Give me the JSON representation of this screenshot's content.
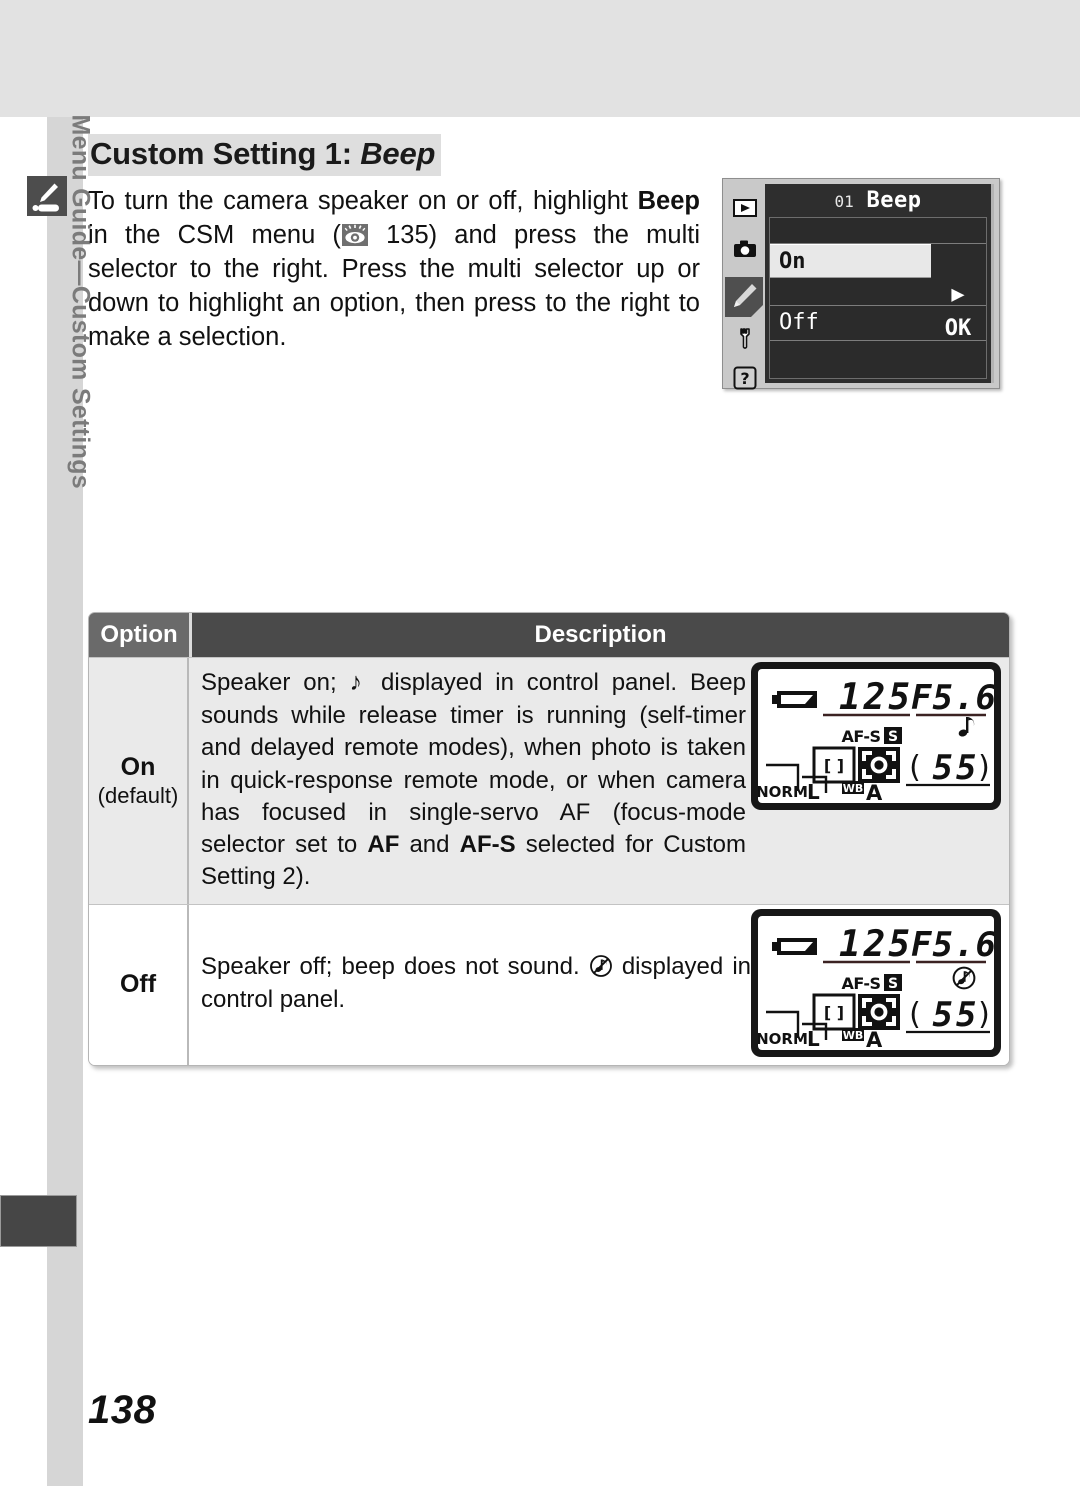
{
  "document": {
    "page_number": "138",
    "side_tab_label": "Menu Guide—Custom Settings",
    "side_tab_icon": "pencil-icon"
  },
  "heading": {
    "prefix": "Custom Setting 1: ",
    "italic_term": "Beep"
  },
  "intro": {
    "part1": "To turn the camera speaker on or off, highlight ",
    "bold_term": "Beep",
    "part2": " in the CSM menu (",
    "ref_icon": "reference-eye-icon",
    "part3": " 135) and press the multi selector to the right.  Press the multi selector up or down to highlight an option, then press to the right to make a selection."
  },
  "menu_screenshot": {
    "title_number": "01",
    "title_name": "Beep",
    "sidebar_icons": [
      "playback-icon",
      "shooting-menu-camera-icon",
      "custom-settings-pencil-icon",
      "setup-wrench-icon",
      "recent-settings-question-icon"
    ],
    "rows": [
      {
        "label": "On",
        "selected": true,
        "action": "▶ OK"
      },
      {
        "label": "Off",
        "selected": false,
        "action": ""
      }
    ]
  },
  "table": {
    "headers": {
      "option": "Option",
      "description": "Description"
    },
    "rows": [
      {
        "option_label": "On",
        "option_default": "(default)",
        "description_a": "Speaker on;  ",
        "description_note_icon": "♪",
        "description_b": " displayed in control panel.  Beep sounds while release timer is running (self-timer and delayed remote modes), when photo is taken in quick-response remote mode, or when camera has focused in single-servo AF (focus-mode selector set to ",
        "description_bold1": "AF",
        "description_c": " and ",
        "description_bold2": "AF-S",
        "description_d": " selected for Custom Setting 2)."
      },
      {
        "option_label": "Off",
        "option_default": "",
        "description_a": "Speaker off; beep does not sound.  ",
        "description_note_icon": "note-muted-icon",
        "description_b": " displayed in control panel."
      }
    ]
  },
  "control_panel": {
    "shutter_speed": "125",
    "aperture": "F5.6",
    "af_mode": "AF-S",
    "release_mode": "S",
    "frames_remaining": "55",
    "frames_bracket_open": "(",
    "frames_bracket_close": ")",
    "quality": "NORM",
    "image_size": "L",
    "wb_label": "WB",
    "wb_value": "A",
    "battery": "battery-full-icon",
    "focus_area": "focus-area-icon",
    "beep_on_icon": "♪",
    "beep_off_icon": "note-muted-icon"
  },
  "colors": {
    "top_band": "#e2e2e2",
    "side_strip": "#d6d6d6",
    "header_dark": "#4a4a4a",
    "header_mid": "#6a6a6a",
    "row_on_bg": "#eaeaea",
    "menu_bg": "#2e2e2e"
  }
}
